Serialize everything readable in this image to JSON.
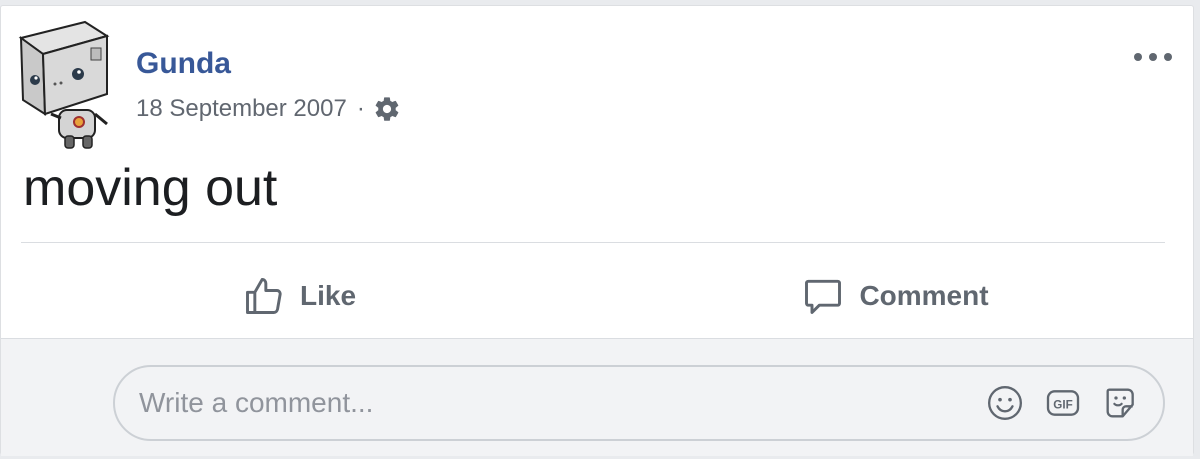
{
  "post": {
    "author": "Gunda",
    "date": "18 September 2007",
    "separator": "·",
    "audience_icon": "gear-icon",
    "text": "moving out",
    "more_icon": "more-options-icon"
  },
  "actions": {
    "like_label": "Like",
    "like_icon": "thumbs-up-icon",
    "comment_label": "Comment",
    "comment_icon": "speech-bubble-icon"
  },
  "comment_box": {
    "placeholder": "Write a comment...",
    "value": "",
    "icons": [
      "emoji-icon",
      "gif-icon",
      "sticker-icon"
    ]
  },
  "colors": {
    "author": "#385898",
    "secondary_text": "#616770",
    "action_text": "#606770",
    "post_text": "#1c1e21",
    "divider": "#dadde1",
    "comment_bg": "#f2f3f5"
  }
}
